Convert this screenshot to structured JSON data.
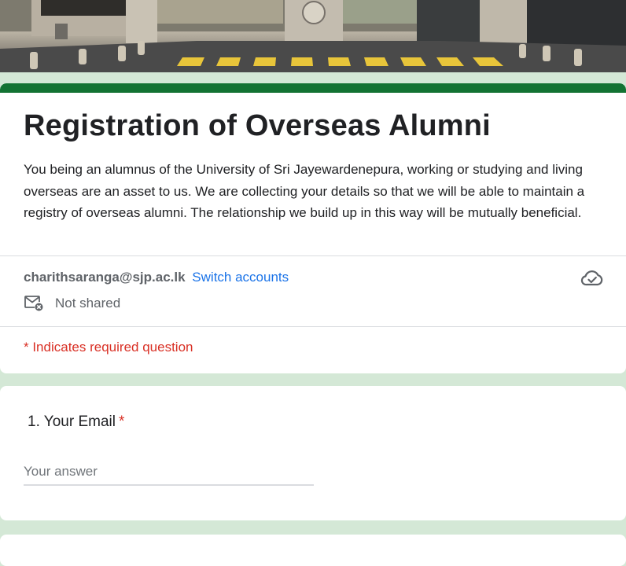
{
  "form": {
    "title": "Registration of Overseas Alumni",
    "description": "You being an alumnus of the University of Sri Jayewardenepura, working or studying and living overseas are an asset to us.  We are collecting your details so that we will be able to maintain a registry of overseas alumni. The relationship we build up in this way will be mutually beneficial.",
    "accent_color": "#137333",
    "background_color": "#d4e8d6"
  },
  "account": {
    "email": "charithsaranga@sjp.ac.lk",
    "switch_label": "Switch accounts",
    "shared_status": "Not shared",
    "save_icon": "cloud-check-icon",
    "shared_icon": "mail-not-shared-icon"
  },
  "required_note": "* Indicates required question",
  "questions": [
    {
      "number": "1.",
      "title": "Your Email",
      "required_mark": "*",
      "placeholder": "Your answer",
      "value": ""
    }
  ]
}
